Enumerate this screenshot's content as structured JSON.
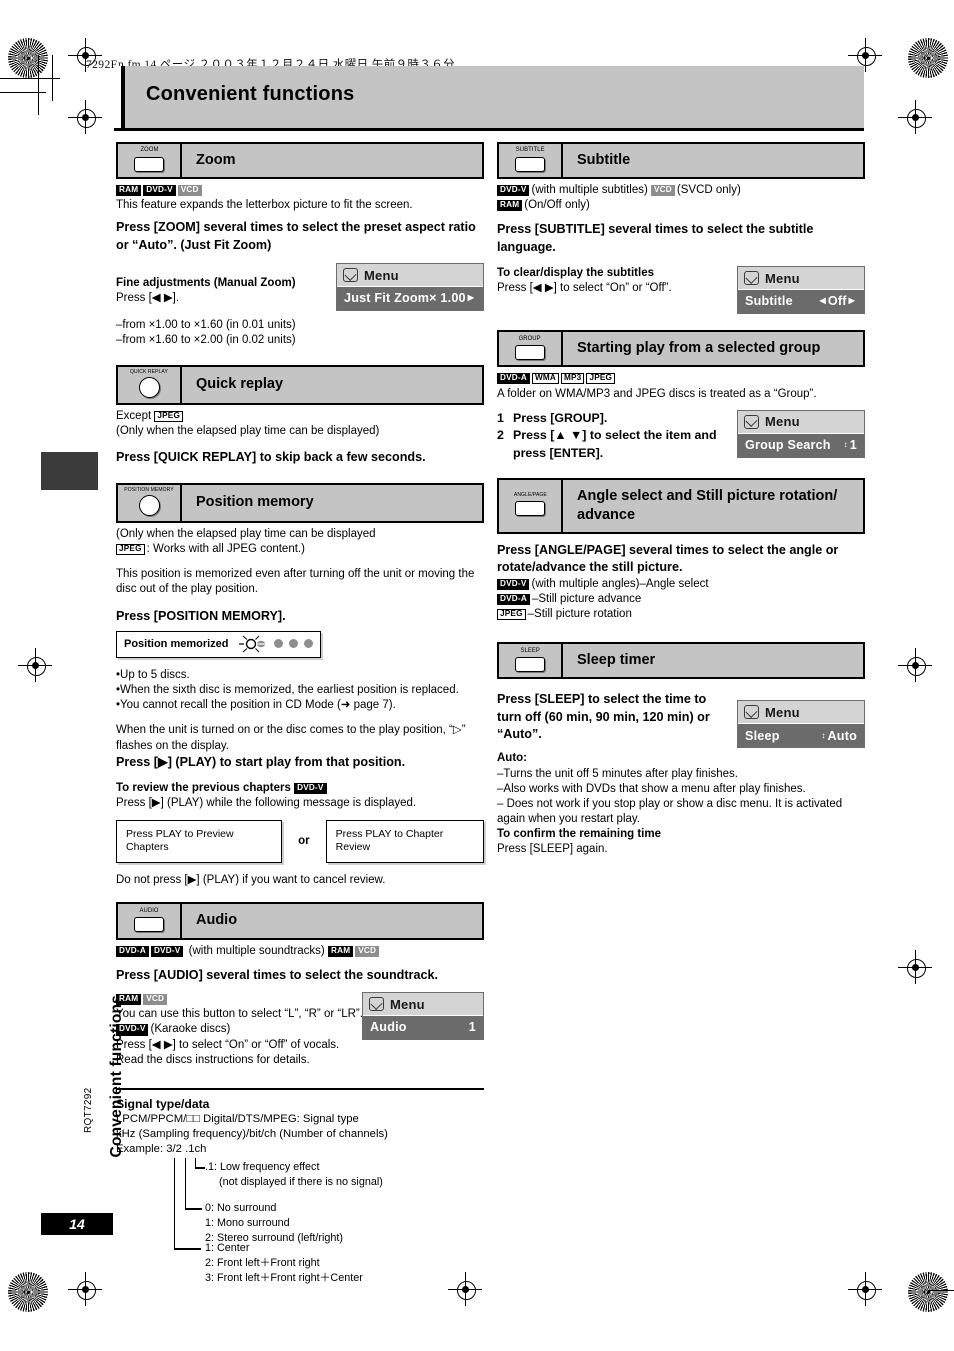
{
  "page": {
    "file_header": "7292En.fm  14 ページ  ２００３年１２月２４日  水曜日  午前９時３６分",
    "title": "Convenient functions",
    "side_tab_label": "Convenient functions",
    "doc_code": "RQT7292",
    "page_number": "14"
  },
  "badges": {
    "ram": "RAM",
    "dvdv": "DVD-V",
    "dvda": "DVD-A",
    "vcd": "VCD",
    "jpeg": "JPEG",
    "wma": "WMA",
    "mp3": "MP3"
  },
  "left": {
    "zoom": {
      "button_label": "ZOOM",
      "title": "Zoom",
      "intro": "This feature expands the letterbox picture to fit the screen.",
      "instruction": "Press [ZOOM] several times to select the preset aspect ratio or “Auto”. (Just Fit Zoom)",
      "fine_heading": "Fine adjustments (Manual Zoom)",
      "fine_press": "Press [◀ ▶].",
      "range1": "–from ×1.00 to ×1.60 (in 0.01 units)",
      "range2": "–from ×1.60 to ×2.00 (in 0.02 units)",
      "menu": {
        "title": "Menu",
        "item": "Just Fit Zoom",
        "value": "× 1.00"
      }
    },
    "quick_replay": {
      "button_label": "QUICK REPLAY",
      "title": "Quick replay",
      "except_label": "Except",
      "note": "(Only when the elapsed play time can be displayed)",
      "instruction": "Press [QUICK REPLAY] to skip back a few seconds."
    },
    "position_memory": {
      "button_label": "POSITION MEMORY",
      "title": "Position memory",
      "note1": "(Only when the elapsed play time can be displayed",
      "note2": ": Works with all JPEG content.)",
      "body": "This position is memorized even after turning off the unit or moving the disc out of the play position.",
      "instruction": "Press [POSITION MEMORY].",
      "display_text": "Position memorized",
      "bullets": [
        "Up to 5 discs.",
        "When the sixth disc is memorized, the earliest position is replaced.",
        "You cannot recall the position in CD Mode (➜ page 7)."
      ],
      "flash_note": "When the unit is turned on or the disc comes to the play position, “▷” flashes on the display.",
      "play_instruction": "Press [▶] (PLAY) to start play from that position.",
      "review_heading": "To review the previous chapters",
      "review_press": "Press [▶] (PLAY) while the following message is displayed.",
      "msg1": "Press PLAY to Preview Chapters",
      "msg_or": "or",
      "msg2": "Press PLAY to Chapter Review",
      "cancel": "Do not press [▶] (PLAY) if you want to cancel review."
    },
    "audio": {
      "button_label": "AUDIO",
      "title": "Audio",
      "disc_note": "(with multiple soundtracks)",
      "instruction": "Press [AUDIO] several times to select the soundtrack.",
      "lr_note": "You can use this button to select “L”, “R” or “LR”.",
      "karaoke_note": "(Karaoke discs)",
      "karaoke_press": "Press [◀ ▶] to select “On” or “Off” of vocals.",
      "read_note": "Read the discs instructions for details.",
      "menu": {
        "title": "Menu",
        "item": "Audio",
        "value": "1"
      }
    },
    "signal": {
      "heading": "Signal type/data",
      "line1": "LPCM/PPCM/□□ Digital/DTS/MPEG:  Signal type",
      "line2": "kHz (Sampling frequency)/bit/ch (Number of channels)",
      "line3": "Example:  3/2 .1ch",
      "tree": [
        ".1: Low frequency effect",
        "(not displayed if there is no signal)",
        "0: No surround",
        "1: Mono surround",
        "2: Stereo surround (left/right)",
        "1: Center",
        "2: Front left＋Front right",
        "3: Front left＋Front right＋Center"
      ]
    }
  },
  "right": {
    "subtitle": {
      "button_label": "SUBTITLE",
      "title": "Subtitle",
      "note_multi": "(with multiple subtitles)",
      "note_svcd": "(SVCD only)",
      "note_onoff": "(On/Off only)",
      "instruction": "Press [SUBTITLE] several times to select the subtitle language.",
      "clear_heading": "To clear/display the subtitles",
      "clear_press": "Press [◀ ▶] to select “On” or “Off”.",
      "menu": {
        "title": "Menu",
        "item": "Subtitle",
        "value": "Off"
      }
    },
    "group": {
      "button_label": "GROUP",
      "title": "Starting play from a selected group",
      "note": "A folder on WMA/MP3 and JPEG discs is treated as a “Group”.",
      "step1_num": "1",
      "step1": "Press [GROUP].",
      "step2_num": "2",
      "step2": "Press [▲ ▼] to select the item and press [ENTER].",
      "menu": {
        "title": "Menu",
        "item": "Group Search",
        "value": "1"
      }
    },
    "angle": {
      "button_label": "ANGLE/PAGE",
      "title": "Angle select and Still picture rotation/ advance",
      "instruction": "Press [ANGLE/PAGE] several times to select the angle or rotate/advance the still picture.",
      "note1": "(with multiple angles)–Angle select",
      "note2": "–Still picture advance",
      "note3": "–Still picture rotation"
    },
    "sleep": {
      "button_label": "SLEEP",
      "title": "Sleep timer",
      "instruction": "Press [SLEEP] to select the time to turn off (60 min, 90 min, 120 min) or “Auto”.",
      "auto_heading": "Auto:",
      "auto1": "–Turns the unit off 5 minutes after play finishes.",
      "auto2": "–Also works with DVDs that show a menu after play finishes.",
      "auto3": "– Does not work if you stop play or show a disc menu. It is activated again when you restart play.",
      "confirm_heading": "To confirm the remaining time",
      "confirm_press": "Press [SLEEP] again.",
      "menu": {
        "title": "Menu",
        "item": "Sleep",
        "value": "Auto"
      }
    }
  }
}
